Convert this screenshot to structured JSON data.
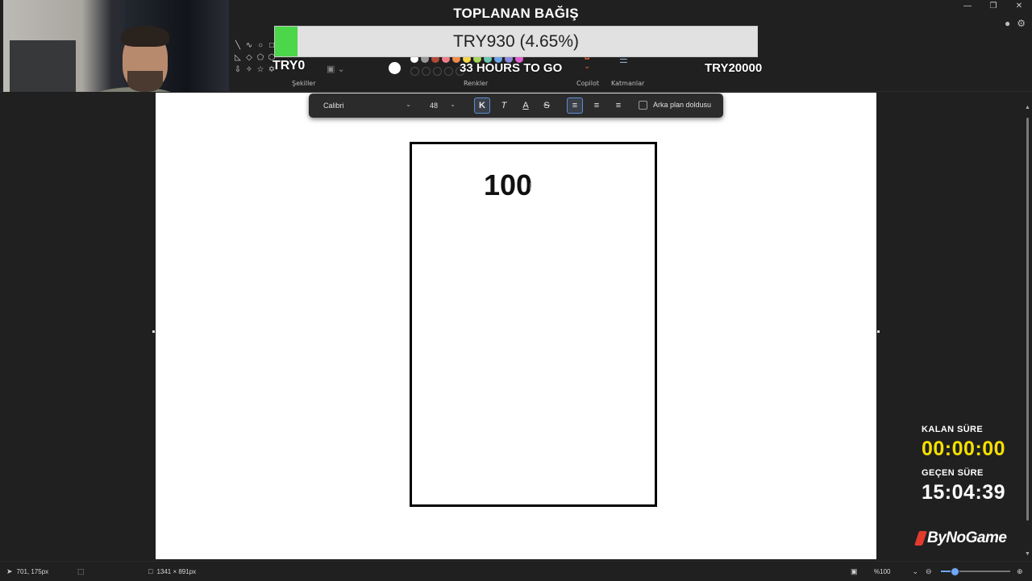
{
  "window": {
    "controls": [
      "minimize-icon",
      "restore-icon",
      "close-icon"
    ],
    "right_icons": [
      "profile-icon",
      "settings-icon"
    ]
  },
  "ribbon": {
    "groups": [
      {
        "name": "shapes",
        "label": "Şekiller"
      },
      {
        "name": "colors",
        "label": "Renkler"
      },
      {
        "name": "copilot",
        "label": "Copilot"
      },
      {
        "name": "layers",
        "label": "Katmanlar"
      }
    ],
    "color_swatches_row1": [
      "#ffffff",
      "#9a9a9a",
      "#b34a3a",
      "#ef7f8a",
      "#f28c4a",
      "#f5d547",
      "#a6d65a",
      "#6cc7b4",
      "#6aa5e8",
      "#8c89e0",
      "#e05fd1"
    ],
    "active_color": "#ffffff"
  },
  "donation_overlay": {
    "title": "TOPLANAN BAĞIŞ",
    "progress_text": "TRY930 (4.65%)",
    "progress_fraction": 0.0465,
    "min_label": "TRY0",
    "time_left": "33 HOURS TO GO",
    "goal_label": "TRY20000",
    "bar_fill_color": "#4cd64a",
    "bar_bg_color": "#e1e1e1"
  },
  "text_toolbar": {
    "font": "Calibri",
    "size": "48",
    "bold_label": "K",
    "italic_label": "T",
    "color_label": "A",
    "strike_label": "S",
    "align_options": [
      "align-left-icon",
      "align-center-icon",
      "align-right-icon"
    ],
    "active_align": "left",
    "background_fill_label": "Arka plan doldusu",
    "background_fill_checked": false
  },
  "canvas": {
    "text": "100"
  },
  "timers": {
    "remaining_label": "KALAN SÜRE",
    "remaining_value": "00:00:00",
    "remaining_color": "#f5e000",
    "elapsed_label": "GEÇEN SÜRE",
    "elapsed_value": "15:04:39"
  },
  "brand": {
    "name": "ByNoGame",
    "accent": "#e23b2e"
  },
  "statusbar": {
    "cursor_pos": "701, 175px",
    "canvas_size": "1341 × 891px",
    "zoom_label": "%100",
    "zoom_fraction": 0.2
  }
}
